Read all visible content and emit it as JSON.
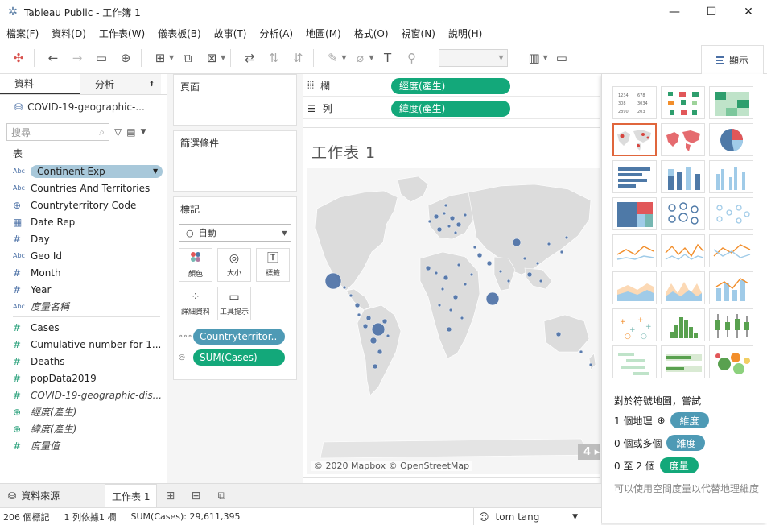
{
  "window": {
    "app_title": "Tableau Public - 工作簿 1",
    "minimize": "—",
    "maximize": "☐",
    "close": "✕"
  },
  "menu": [
    "檔案(F)",
    "資料(D)",
    "工作表(W)",
    "儀表板(B)",
    "故事(T)",
    "分析(A)",
    "地圖(M)",
    "格式(O)",
    "視窗(N)",
    "說明(H)"
  ],
  "toolbar": {
    "show_me_label": "顯示"
  },
  "left_pane": {
    "tabs": {
      "data": "資料",
      "analytics": "分析"
    },
    "datasource_name": "COVID-19-geographic-...",
    "search_placeholder": "搜尋",
    "tables_label": "表",
    "dimensions": [
      {
        "type": "Abc",
        "name": "Continent Exp",
        "selected": true
      },
      {
        "type": "Abc",
        "name": "Countries And Territories"
      },
      {
        "type": "geo",
        "name": "Countryterritory Code"
      },
      {
        "type": "date",
        "name": "Date Rep"
      },
      {
        "type": "#",
        "name": "Day"
      },
      {
        "type": "Abc",
        "name": "Geo Id"
      },
      {
        "type": "#",
        "name": "Month"
      },
      {
        "type": "#",
        "name": "Year"
      },
      {
        "type": "Abc",
        "name": "度量名稱",
        "italic": true
      }
    ],
    "measures": [
      {
        "type": "#",
        "name": "Cases"
      },
      {
        "type": "#",
        "name": "Cumulative number for 1..."
      },
      {
        "type": "#",
        "name": "Deaths"
      },
      {
        "type": "#",
        "name": "popData2019"
      },
      {
        "type": "#",
        "name": "COVID-19-geographic-dis...",
        "italic": true
      },
      {
        "type": "geo",
        "name": "經度(產生)",
        "italic": true
      },
      {
        "type": "geo",
        "name": "緯度(產生)",
        "italic": true
      },
      {
        "type": "#",
        "name": "度量值",
        "italic": true
      }
    ]
  },
  "cards": {
    "pages": "頁面",
    "filters": "篩選條件",
    "marks": "標記",
    "marks_type": "自動",
    "mark_buttons": [
      "顏色",
      "大小",
      "標籤",
      "詳細資料",
      "工具提示"
    ],
    "pill_detail": "Countryterritor..",
    "pill_size": "SUM(Cases)"
  },
  "shelves": {
    "columns_label": "欄",
    "columns_pill": "經度(產生)",
    "rows_label": "列",
    "rows_pill": "緯度(產生)"
  },
  "view": {
    "sheet_title": "工作表 1",
    "map_credit": "© 2020 Mapbox © OpenStreetMap",
    "badge": "4 ▸"
  },
  "show_me": {
    "hint": "對於符號地圖，嘗試",
    "req1_text": "1 個地理",
    "req1_tag": "維度",
    "req2_text": "0 個或多個",
    "req2_tag": "維度",
    "req3_text": "0 至 2 個",
    "req3_tag": "度量",
    "note": "可以使用空間度量以代替地理維度"
  },
  "sheet_tabs": {
    "datasource": "資料來源",
    "sheet1": "工作表 1"
  },
  "status": {
    "marks": "206 個標記",
    "rowscols": "1 列依據1 欄",
    "sum": "SUM(Cases): 29,611,395",
    "user": "tom tang"
  },
  "colors": {
    "accent_green": "#13a87a",
    "accent_blue": "#4e9ab5",
    "selected_border": "#e0663c",
    "bubble": "#4a6fa5"
  }
}
